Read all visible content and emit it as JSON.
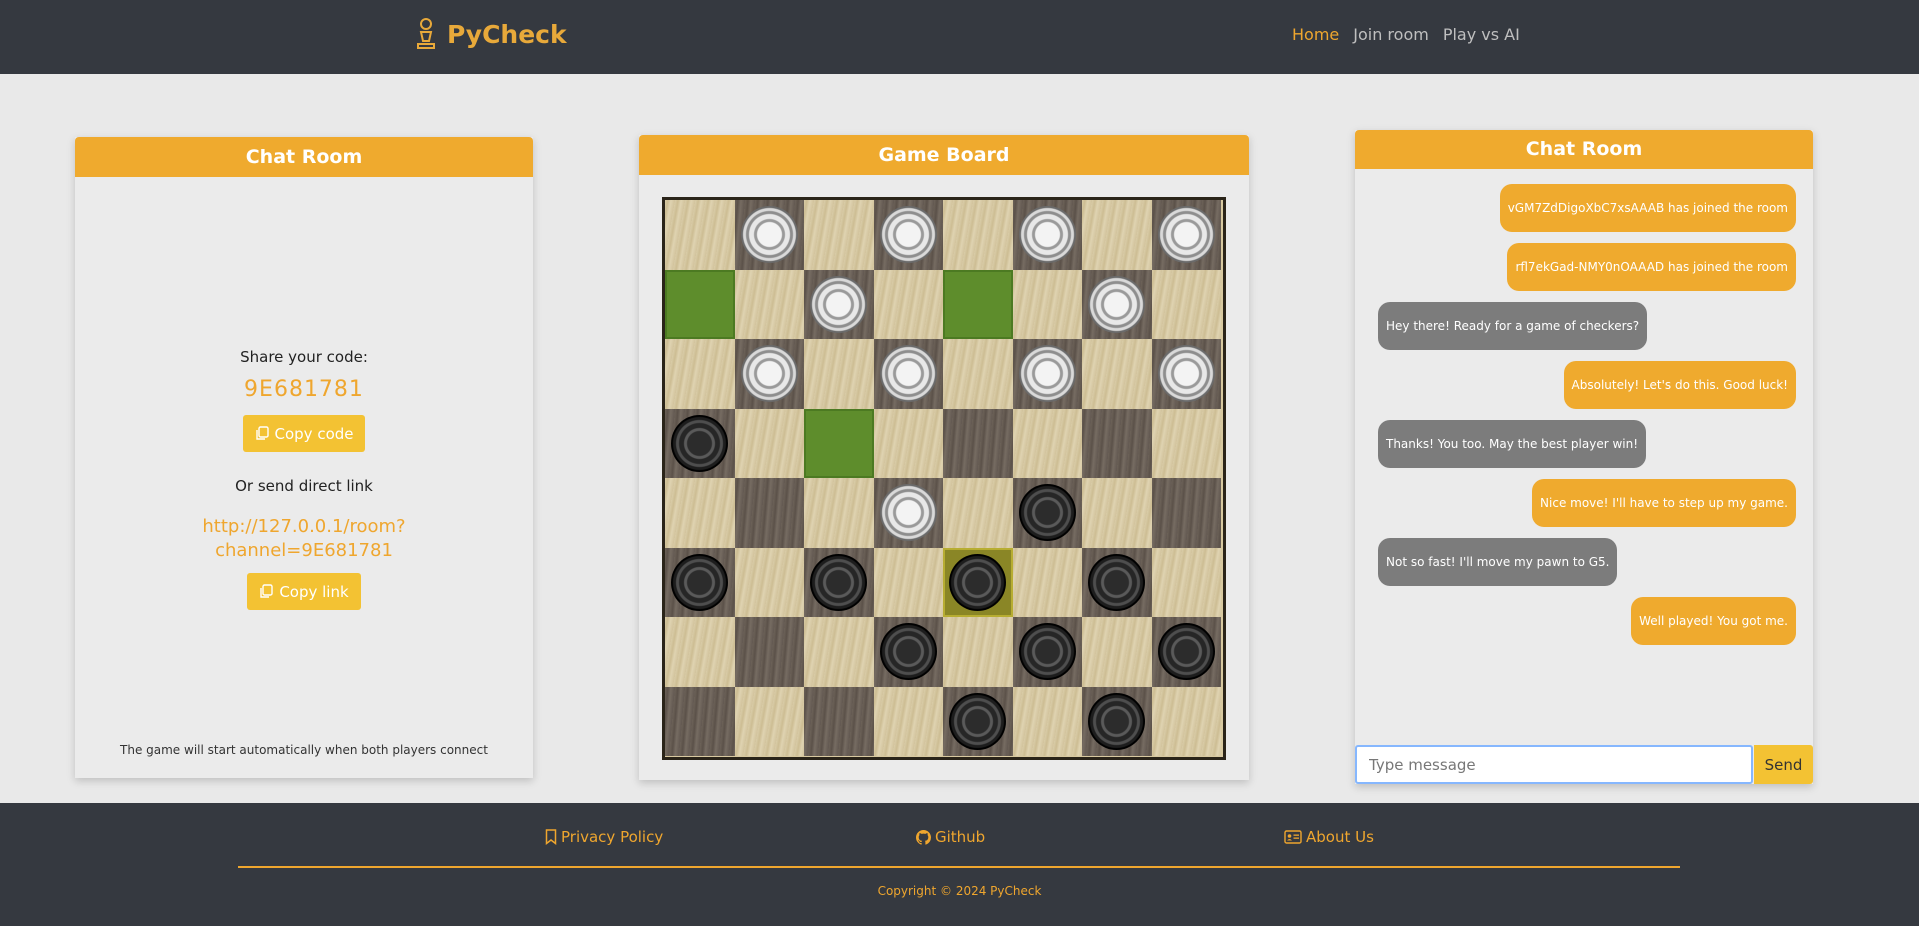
{
  "header": {
    "brand": "PyCheck",
    "nav": [
      {
        "label": "Home",
        "active": true
      },
      {
        "label": "Join room",
        "active": false
      },
      {
        "label": "Play vs AI",
        "active": false
      }
    ],
    "colors": {
      "background": "#353940",
      "accent": "#efa62e"
    }
  },
  "share_panel": {
    "title": "Chat Room",
    "share_label": "Share your code:",
    "code": "9E681781",
    "copy_code_label": "Copy code",
    "or_label": "Or send direct link",
    "link_line1": "http://127.0.0.1/room?",
    "link_line2": "channel=9E681781",
    "copy_link_label": "Copy link",
    "start_note": "The game will start automatically when both players connect"
  },
  "board_panel": {
    "title": "Game Board",
    "rows": [
      [
        "",
        "w",
        "",
        "w",
        "",
        "w",
        "",
        "w"
      ],
      [
        "G",
        "",
        "w",
        "",
        "G",
        "",
        "w",
        ""
      ],
      [
        "",
        "w",
        "",
        "w",
        "",
        "w",
        "",
        "w"
      ],
      [
        "b",
        "",
        "G",
        "",
        "",
        "",
        "",
        ""
      ],
      [
        "",
        "",
        "",
        "w",
        "",
        "b",
        "",
        ""
      ],
      [
        "b",
        "",
        "b",
        "",
        "bY",
        "",
        "b",
        ""
      ],
      [
        "",
        "",
        "",
        "b",
        "",
        "b",
        "",
        "b"
      ],
      [
        "",
        "",
        "",
        "",
        "b",
        "",
        "b",
        ""
      ]
    ],
    "legend_codes": {
      "w": "white piece",
      "b": "black piece",
      "G": "highlighted move square",
      "Y": "selected square"
    }
  },
  "chat_panel": {
    "title": "Chat Room",
    "messages": [
      {
        "text": "vGM7ZdDigoXbC7xsAAAB has joined the room",
        "side": "mine"
      },
      {
        "text": "rfl7ekGad-NMY0nOAAAD has joined the room",
        "side": "mine"
      },
      {
        "text": "Hey there! Ready for a game of checkers?",
        "side": "theirs"
      },
      {
        "text": "Absolutely! Let's do this. Good luck!",
        "side": "mine"
      },
      {
        "text": "Thanks! You too. May the best player win!",
        "side": "theirs"
      },
      {
        "text": "Nice move! I'll have to step up my game.",
        "side": "mine"
      },
      {
        "text": "Not so fast! I'll move my pawn to G5.",
        "side": "theirs"
      },
      {
        "text": "Well played! You got me.",
        "side": "mine"
      }
    ],
    "input_placeholder": "Type message",
    "send_label": "Send"
  },
  "footer": {
    "privacy_label": "Privacy Policy",
    "github_label": "Github",
    "about_label": "About Us",
    "copyright": "Copyright © 2024 PyCheck"
  }
}
